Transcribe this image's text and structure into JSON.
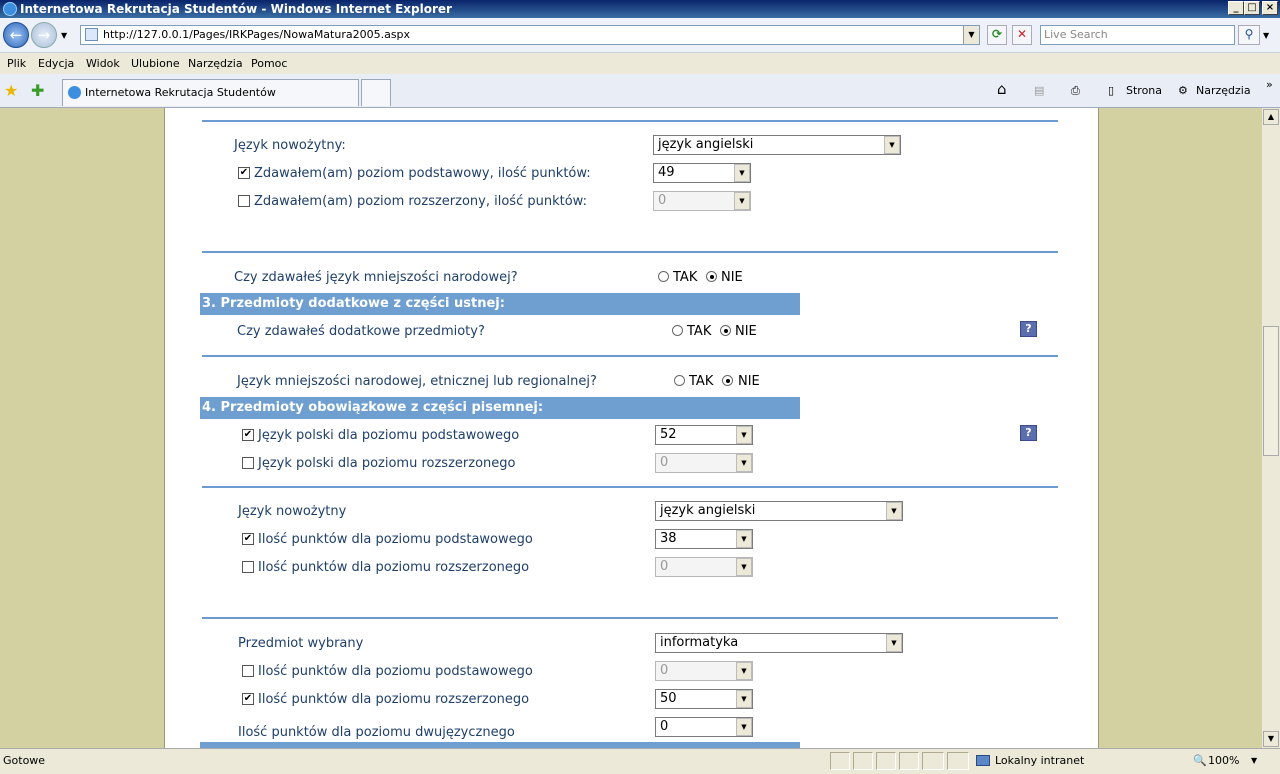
{
  "window": {
    "title": "Internetowa Rekrutacja Studentów - Windows Internet Explorer"
  },
  "address": {
    "url": "http://127.0.0.1/Pages/IRKPages/NowaMatura2005.aspx",
    "search_placeholder": "Live Search"
  },
  "menu": {
    "items": [
      "Plik",
      "Edycja",
      "Widok",
      "Ulubione",
      "Narzędzia",
      "Pomoc"
    ]
  },
  "tab": {
    "title": "Internetowa Rekrutacja Studentów"
  },
  "toolbar": {
    "page_label": "Strona",
    "tools_label": "Narzędzia"
  },
  "form": {
    "block1": {
      "lang_label": "Język nowożytny:",
      "lang_value": "język angielski",
      "basic_label": "Zdawałem(am) poziom podstawowy, ilość punktów:",
      "basic_value": "49",
      "basic_checked": true,
      "ext_label": "Zdawałem(am) poziom rozszerzony, ilość punktów:",
      "ext_value": "0",
      "ext_checked": false
    },
    "minority_q": {
      "label": "Czy zdawałeś język mniejszości narodowej?",
      "yes": "TAK",
      "no": "NIE",
      "selected": "NIE"
    },
    "section3": {
      "title": "3. Przedmioty dodatkowe z części ustnej:"
    },
    "extra_q": {
      "label": "Czy zdawałeś dodatkowe przedmioty?",
      "yes": "TAK",
      "no": "NIE",
      "selected": "NIE"
    },
    "regional_q": {
      "label": "Język mniejszości narodowej, etnicznej lub regionalnej?",
      "yes": "TAK",
      "no": "NIE",
      "selected": "NIE"
    },
    "section4": {
      "title": "4. Przedmioty obowiązkowe z części pisemnej:"
    },
    "polish": {
      "basic_label": "Język polski dla poziomu podstawowego",
      "basic_value": "52",
      "basic_checked": true,
      "ext_label": "Język polski dla poziomu rozszerzonego",
      "ext_value": "0",
      "ext_checked": false
    },
    "modern": {
      "lang_label": "Język nowożytny",
      "lang_value": "język angielski",
      "basic_label": "Ilość punktów dla poziomu podstawowego",
      "basic_value": "38",
      "basic_checked": true,
      "ext_label": "Ilość punktów dla poziomu rozszerzonego",
      "ext_value": "0",
      "ext_checked": false
    },
    "chosen": {
      "subject_label": "Przedmiot wybrany",
      "subject_value": "informatyka",
      "basic_label": "Ilość punktów dla poziomu podstawowego",
      "basic_value": "0",
      "basic_checked": false,
      "ext_label": "Ilość punktów dla poziomu rozszerzonego",
      "ext_value": "50",
      "ext_checked": true,
      "bilingual_label": "Ilość punktów dla poziomu dwujęzycznego",
      "bilingual_value": "0"
    },
    "help_symbol": "?"
  },
  "status": {
    "text": "Gotowe",
    "zone": "Lokalny intranet",
    "zoom": "100%"
  }
}
